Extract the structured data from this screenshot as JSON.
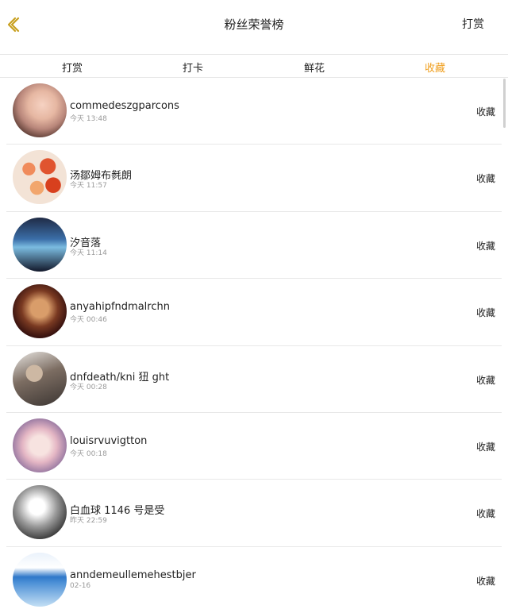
{
  "header": {
    "title": "粉丝荣誉榜",
    "action_label": "打赏"
  },
  "tabs": [
    {
      "label": "打赏",
      "active": false
    },
    {
      "label": "打卡",
      "active": false
    },
    {
      "label": "鲜花",
      "active": false
    },
    {
      "label": "收藏",
      "active": true
    }
  ],
  "colors": {
    "active_tab": "#f0a020",
    "back_icon": "#c8a020"
  },
  "list": {
    "rows": [
      {
        "name": "commedeszgparcons",
        "time": "今天 13:48",
        "action": "收藏"
      },
      {
        "name": "汤鄒姆布毵朗",
        "time": "今天 11:57",
        "action": "收藏"
      },
      {
        "name": "汐音落",
        "time": "今天 11:14",
        "action": "收藏"
      },
      {
        "name": "anyahipfndmalrchn",
        "time": "今天 00:46",
        "action": "收藏"
      },
      {
        "name": "dnfdeath/kni 狃 ght",
        "time": "今天 00:28",
        "action": "收藏"
      },
      {
        "name": "louisrvuvigtton",
        "time": "今天 00:18",
        "action": "收藏"
      },
      {
        "name": "白血球 1146 号是受",
        "time": "昨天 22:59",
        "action": "收藏"
      },
      {
        "name": "anndemeullemehestbjer",
        "time": "02-16",
        "action": "收藏"
      }
    ]
  }
}
